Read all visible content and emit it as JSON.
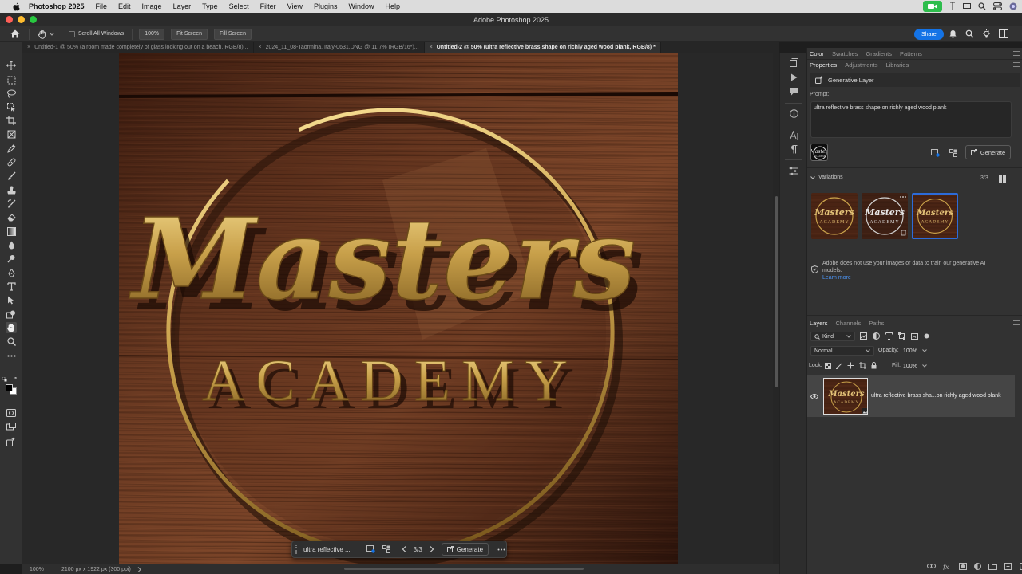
{
  "menubar": {
    "app_name": "Photoshop 2025",
    "items": [
      "File",
      "Edit",
      "Image",
      "Layer",
      "Type",
      "Select",
      "Filter",
      "View",
      "Plugins",
      "Window",
      "Help"
    ]
  },
  "window": {
    "title": "Adobe Photoshop 2025"
  },
  "options": {
    "scroll_all": "Scroll All Windows",
    "zoom_100": "100%",
    "fit_screen": "Fit Screen",
    "fill_screen": "Fill Screen",
    "share": "Share"
  },
  "tabs": [
    {
      "label": "Untitled-1 @ 50% (a room made completely of glass looking out on a beach, RGB/8)..."
    },
    {
      "label": "2024_11_08-Taormina, Italy-0631.DNG @ 11.7% (RGB/16*)..."
    },
    {
      "label": "Untitled-2 @ 50% (ultra reflective brass shape on richly aged wood plank, RGB/8) *"
    }
  ],
  "artwork": {
    "line1": "Masters",
    "line2": "ACADEMY"
  },
  "contextual_bar": {
    "prompt": "ultra reflective ...",
    "count": "3/3",
    "generate": "Generate"
  },
  "status": {
    "zoom": "100%",
    "dimensions": "2100 px x 1922 px (300 ppi)"
  },
  "panels": {
    "top_tabs": [
      "Color",
      "Swatches",
      "Gradients",
      "Patterns"
    ],
    "prop_tabs": [
      "Properties",
      "Adjustments",
      "Libraries"
    ],
    "layer_type": "Generative Layer",
    "prompt_label": "Prompt:",
    "prompt_text": "ultra reflective brass shape on richly aged wood plank",
    "generate": "Generate",
    "variations_label": "Variations",
    "variations_count": "3/3",
    "notice": "Adobe does not use your images or data to train our generative AI models.",
    "learn_more": "Learn more",
    "layer_tabs": [
      "Layers",
      "Channels",
      "Paths"
    ],
    "kind": "Kind",
    "blend_mode": "Normal",
    "opacity_label": "Opacity:",
    "opacity": "100%",
    "lock_label": "Lock:",
    "fill_label": "Fill:",
    "fill": "100%",
    "layer_name": "ultra reflective brass sha...on richly aged wood plank"
  },
  "colors": {
    "accent": "#1473e6",
    "selection": "#2c6bd9",
    "brass": "#c9a24a",
    "wood": "#5a2e1a"
  }
}
